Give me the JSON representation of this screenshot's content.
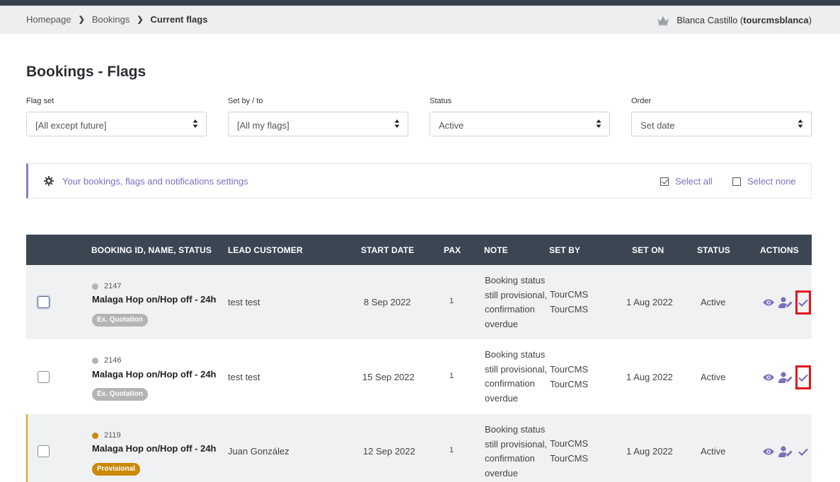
{
  "breadcrumb": {
    "items": [
      "Homepage",
      "Bookings"
    ],
    "current": "Current flags"
  },
  "user": {
    "name_prefix": "Blanca Castillo (",
    "username": "tourcmsblanca",
    "name_suffix": ")",
    "icon": "crown-icon"
  },
  "page": {
    "title": "Bookings - Flags"
  },
  "filters": [
    {
      "label": "Flag set",
      "value": "[All except future]"
    },
    {
      "label": "Set by / to",
      "value": "[All my flags]"
    },
    {
      "label": "Status",
      "value": "Active"
    },
    {
      "label": "Order",
      "value": "Set date"
    }
  ],
  "settings": {
    "link": "Your bookings, flags and notifications settings",
    "select_all": "Select all",
    "select_none": "Select none",
    "select_all_checked": true,
    "select_none_checked": false
  },
  "table": {
    "headers": {
      "booking": "BOOKING ID, NAME, STATUS",
      "lead": "LEAD CUSTOMER",
      "start": "START DATE",
      "pax": "PAX",
      "note": "NOTE",
      "setby": "SET BY",
      "seton": "SET ON",
      "status": "STATUS",
      "actions": "ACTIONS"
    },
    "rows": [
      {
        "id": "2147",
        "name": "Malaga Hop on/Hop off - 24h",
        "badge": "Ex. Quotation",
        "badge_color": "#b4b4b4",
        "dot_color": "#b4b4b4",
        "lead": "test test",
        "start": "8 Sep 2022",
        "pax": "1",
        "note_lines": [
          "Booking status",
          "still provisional,",
          "confirmation",
          "overdue"
        ],
        "setby_lines": [
          "TourCMS",
          "TourCMS"
        ],
        "seton": "1 Aug 2022",
        "status": "Active"
      },
      {
        "id": "2146",
        "name": "Malaga Hop on/Hop off - 24h",
        "badge": "Ex. Quotation",
        "badge_color": "#b4b4b4",
        "dot_color": "#b4b4b4",
        "lead": "test test",
        "start": "15 Sep 2022",
        "pax": "1",
        "note_lines": [
          "Booking status",
          "still provisional,",
          "confirmation",
          "overdue"
        ],
        "setby_lines": [
          "TourCMS",
          "TourCMS"
        ],
        "seton": "1 Aug 2022",
        "status": "Active"
      },
      {
        "id": "2119",
        "name": "Malaga Hop on/Hop off - 24h",
        "badge": "Provisional",
        "badge_color": "#c98a0a",
        "dot_color": "#c98a0a",
        "lead": "Juan González",
        "start": "12 Sep 2022",
        "pax": "1",
        "note_lines": [
          "Booking status",
          "still provisional,",
          "confirmation",
          "overdue"
        ],
        "setby_lines": [
          "TourCMS",
          "TourCMS"
        ],
        "seton": "1 Aug 2022",
        "status": "Active"
      }
    ]
  },
  "colors": {
    "accent": "#7b6fbf",
    "header_bg": "#3b4652",
    "highlight": "#e3141d",
    "provisional": "#c98a0a"
  }
}
